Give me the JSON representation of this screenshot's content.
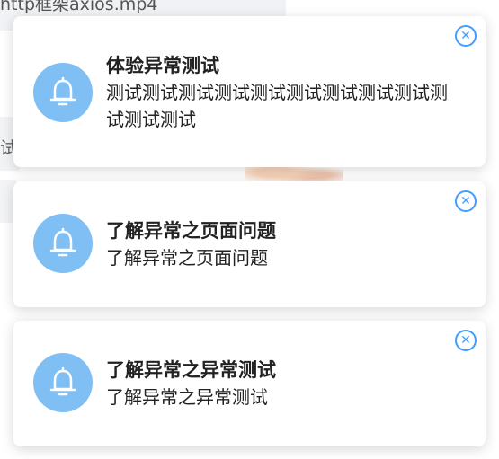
{
  "background": {
    "top_text": "http框架axios.mp4",
    "left_text": "试"
  },
  "notifications": [
    {
      "title": "体验异常测试",
      "message": "测试测试测试测试测试测试测试测试测试测试测试测试",
      "icon": "bell-icon",
      "close_icon": "close-icon"
    },
    {
      "title": "了解异常之页面问题",
      "message": "了解异常之页面问题",
      "icon": "bell-icon",
      "close_icon": "close-icon"
    },
    {
      "title": "了解异常之异常测试",
      "message": "了解异常之异常测试",
      "icon": "bell-icon",
      "close_icon": "close-icon"
    }
  ],
  "colors": {
    "icon_bg": "#7fbff3",
    "close_accent": "#409eff"
  }
}
